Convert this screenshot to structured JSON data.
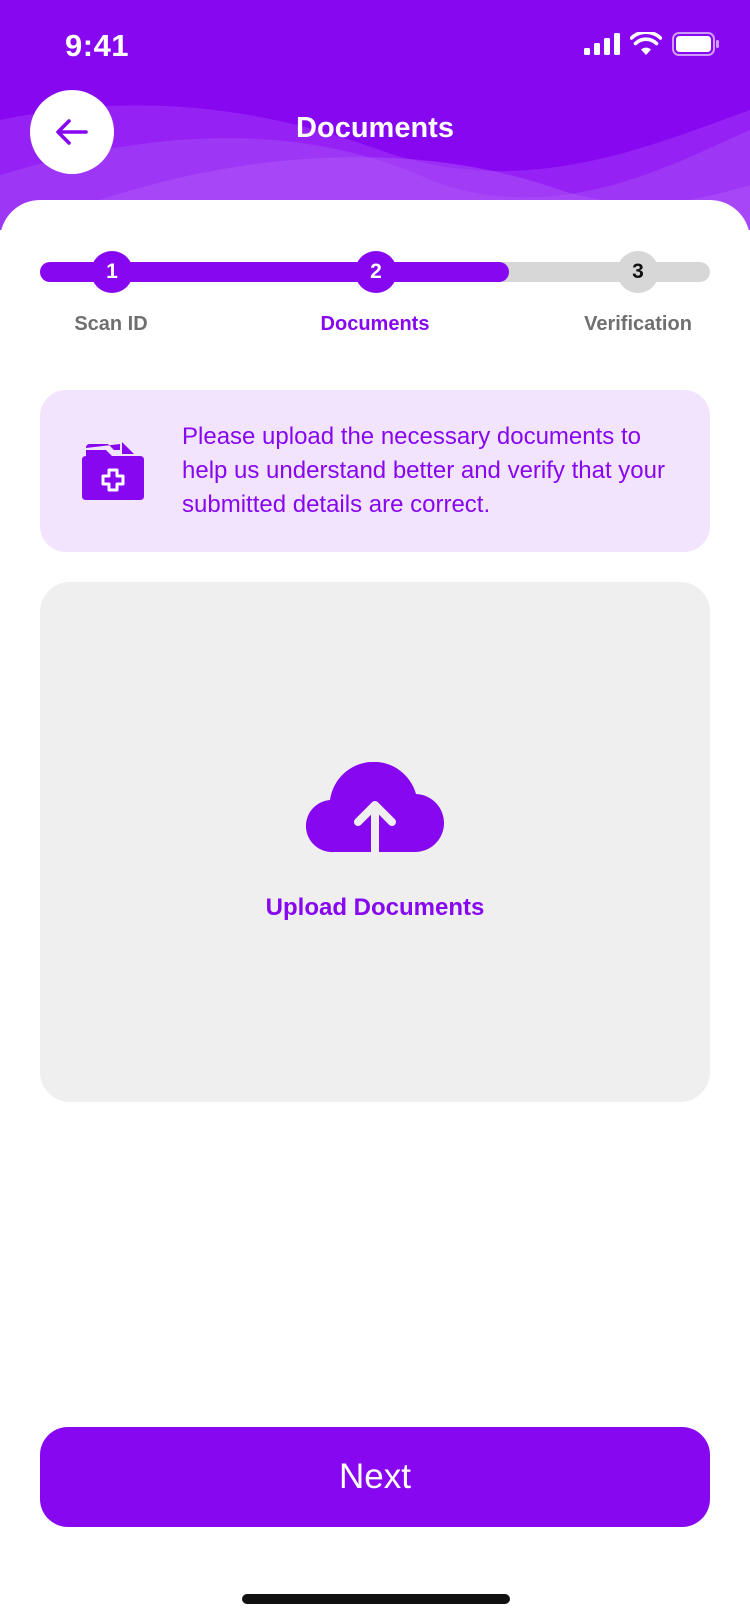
{
  "status_bar": {
    "time": "9:41",
    "icons": [
      "cellular-signal-icon",
      "wifi-icon",
      "battery-icon"
    ]
  },
  "header": {
    "title": "Documents",
    "back_icon": "arrow-left-icon"
  },
  "stepper": {
    "progress_fraction": 0.7,
    "steps": [
      {
        "number": "1",
        "label": "Scan ID",
        "state": "done"
      },
      {
        "number": "2",
        "label": "Documents",
        "state": "current"
      },
      {
        "number": "3",
        "label": "Verification",
        "state": "pending"
      }
    ]
  },
  "info_banner": {
    "icon": "folder-add-icon",
    "text": "Please upload the necessary documents to help us understand better and verify that your submitted details are correct."
  },
  "upload": {
    "icon": "cloud-upload-icon",
    "label": "Upload Documents"
  },
  "footer": {
    "next_label": "Next"
  },
  "colors": {
    "accent": "#8707f0",
    "accent_light": "#f3e4fd",
    "track_inactive": "#d7d7d7",
    "upload_bg": "#efefef"
  }
}
